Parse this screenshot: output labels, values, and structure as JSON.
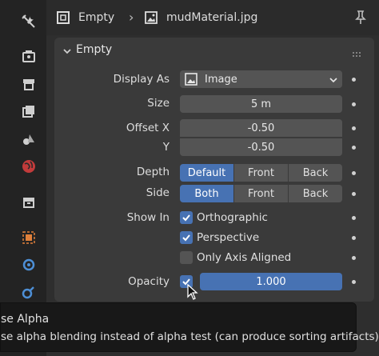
{
  "header": {
    "object_name": "Empty",
    "material_name": "mudMaterial.jpg"
  },
  "panel": {
    "title": "Empty",
    "display_as": {
      "label": "Display As",
      "value": "Image"
    },
    "size": {
      "label": "Size",
      "value": "5 m"
    },
    "offset_x": {
      "label": "Offset X",
      "value": "-0.50"
    },
    "offset_y": {
      "label": "Y",
      "value": "-0.50"
    },
    "depth": {
      "label": "Depth",
      "options": [
        "Default",
        "Front",
        "Back"
      ],
      "selected": "Default"
    },
    "side": {
      "label": "Side",
      "options": [
        "Both",
        "Front",
        "Back"
      ],
      "selected": "Both"
    },
    "show_in": {
      "label": "Show In",
      "orthographic": {
        "label": "Orthographic",
        "checked": true
      },
      "perspective": {
        "label": "Perspective",
        "checked": true
      },
      "only_axis_aligned": {
        "label": "Only Axis Aligned",
        "checked": false
      }
    },
    "opacity": {
      "label": "Opacity",
      "checked": true,
      "value": "1.000"
    }
  },
  "tooltip": {
    "title": "se Alpha",
    "description": "se alpha blending instead of alpha test (can produce sorting artifacts)."
  },
  "colors": {
    "accent": "#4772b3",
    "panel": "#3a3a3a",
    "field": "#545454"
  }
}
